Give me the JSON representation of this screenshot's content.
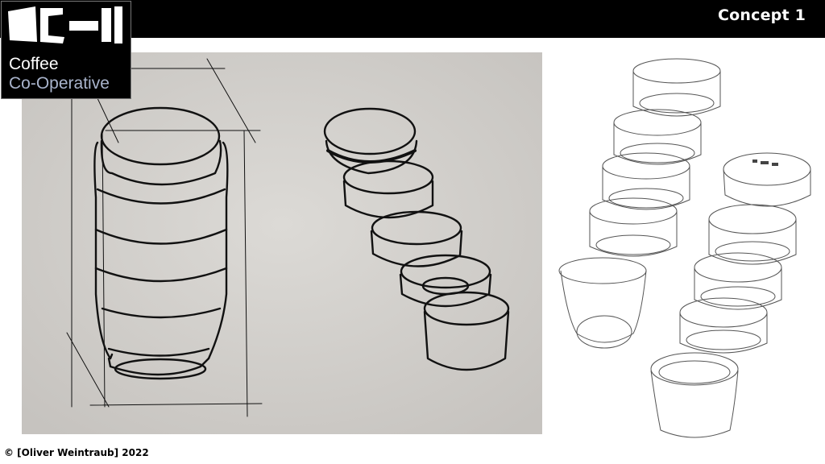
{
  "header": {
    "title": "Concept 1"
  },
  "logo": {
    "line1": "Coffee",
    "line2": "Co-Operative",
    "accent_color": "#a9b4cc"
  },
  "images": {
    "sketch": "hand-drawn-sketch",
    "cad": "cad-line-drawing"
  },
  "footer": {
    "copyright": "© [Oliver Weintraub] 2022"
  }
}
